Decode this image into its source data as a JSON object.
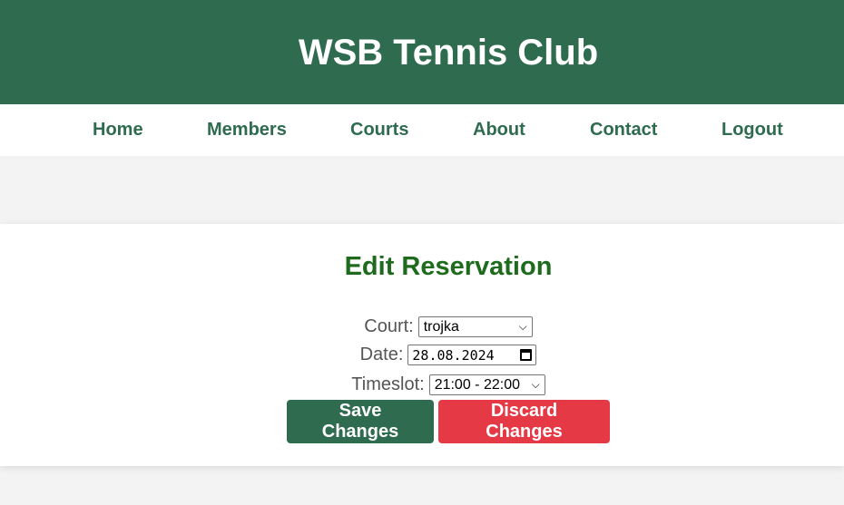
{
  "header": {
    "title": "WSB Tennis Club"
  },
  "nav": {
    "items": [
      {
        "label": "Home"
      },
      {
        "label": "Members"
      },
      {
        "label": "Courts"
      },
      {
        "label": "About"
      },
      {
        "label": "Contact"
      },
      {
        "label": "Logout"
      }
    ]
  },
  "form": {
    "title": "Edit Reservation",
    "court": {
      "label": "Court:",
      "value": "trojka"
    },
    "date": {
      "label": "Date:",
      "value": "28.08.2024"
    },
    "timeslot": {
      "label": "Timeslot:",
      "value": "21:00 - 22:00"
    },
    "save_label": "Save Changes",
    "discard_label": "Discard Changes"
  },
  "colors": {
    "brand_green": "#2e6b4f",
    "title_green": "#1e6b1e",
    "discard_red": "#e63946"
  },
  "icons": {
    "select_chevron": "chevron-down-icon",
    "date_picker": "calendar-icon"
  }
}
